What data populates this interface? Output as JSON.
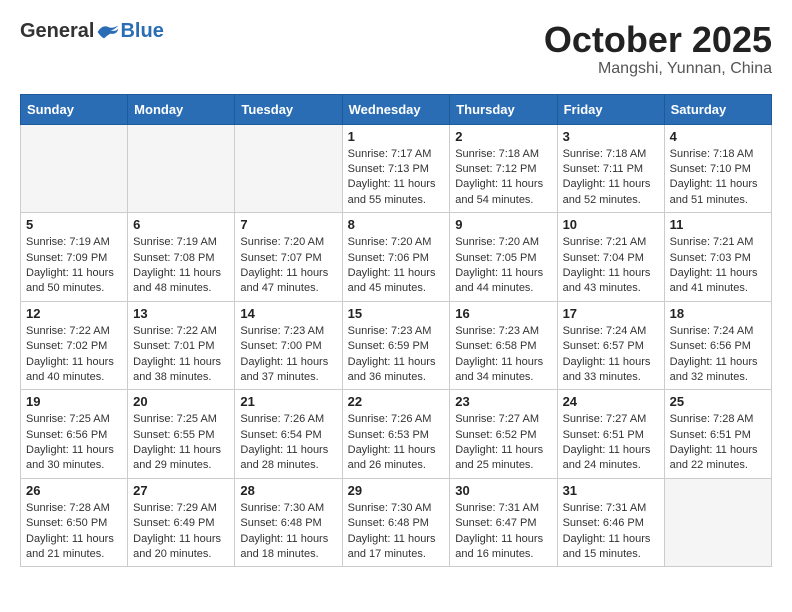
{
  "logo": {
    "general": "General",
    "blue": "Blue"
  },
  "title": "October 2025",
  "location": "Mangshi, Yunnan, China",
  "days_of_week": [
    "Sunday",
    "Monday",
    "Tuesday",
    "Wednesday",
    "Thursday",
    "Friday",
    "Saturday"
  ],
  "weeks": [
    [
      {
        "day": "",
        "info": ""
      },
      {
        "day": "",
        "info": ""
      },
      {
        "day": "",
        "info": ""
      },
      {
        "day": "1",
        "info": "Sunrise: 7:17 AM\nSunset: 7:13 PM\nDaylight: 11 hours and 55 minutes."
      },
      {
        "day": "2",
        "info": "Sunrise: 7:18 AM\nSunset: 7:12 PM\nDaylight: 11 hours and 54 minutes."
      },
      {
        "day": "3",
        "info": "Sunrise: 7:18 AM\nSunset: 7:11 PM\nDaylight: 11 hours and 52 minutes."
      },
      {
        "day": "4",
        "info": "Sunrise: 7:18 AM\nSunset: 7:10 PM\nDaylight: 11 hours and 51 minutes."
      }
    ],
    [
      {
        "day": "5",
        "info": "Sunrise: 7:19 AM\nSunset: 7:09 PM\nDaylight: 11 hours and 50 minutes."
      },
      {
        "day": "6",
        "info": "Sunrise: 7:19 AM\nSunset: 7:08 PM\nDaylight: 11 hours and 48 minutes."
      },
      {
        "day": "7",
        "info": "Sunrise: 7:20 AM\nSunset: 7:07 PM\nDaylight: 11 hours and 47 minutes."
      },
      {
        "day": "8",
        "info": "Sunrise: 7:20 AM\nSunset: 7:06 PM\nDaylight: 11 hours and 45 minutes."
      },
      {
        "day": "9",
        "info": "Sunrise: 7:20 AM\nSunset: 7:05 PM\nDaylight: 11 hours and 44 minutes."
      },
      {
        "day": "10",
        "info": "Sunrise: 7:21 AM\nSunset: 7:04 PM\nDaylight: 11 hours and 43 minutes."
      },
      {
        "day": "11",
        "info": "Sunrise: 7:21 AM\nSunset: 7:03 PM\nDaylight: 11 hours and 41 minutes."
      }
    ],
    [
      {
        "day": "12",
        "info": "Sunrise: 7:22 AM\nSunset: 7:02 PM\nDaylight: 11 hours and 40 minutes."
      },
      {
        "day": "13",
        "info": "Sunrise: 7:22 AM\nSunset: 7:01 PM\nDaylight: 11 hours and 38 minutes."
      },
      {
        "day": "14",
        "info": "Sunrise: 7:23 AM\nSunset: 7:00 PM\nDaylight: 11 hours and 37 minutes."
      },
      {
        "day": "15",
        "info": "Sunrise: 7:23 AM\nSunset: 6:59 PM\nDaylight: 11 hours and 36 minutes."
      },
      {
        "day": "16",
        "info": "Sunrise: 7:23 AM\nSunset: 6:58 PM\nDaylight: 11 hours and 34 minutes."
      },
      {
        "day": "17",
        "info": "Sunrise: 7:24 AM\nSunset: 6:57 PM\nDaylight: 11 hours and 33 minutes."
      },
      {
        "day": "18",
        "info": "Sunrise: 7:24 AM\nSunset: 6:56 PM\nDaylight: 11 hours and 32 minutes."
      }
    ],
    [
      {
        "day": "19",
        "info": "Sunrise: 7:25 AM\nSunset: 6:56 PM\nDaylight: 11 hours and 30 minutes."
      },
      {
        "day": "20",
        "info": "Sunrise: 7:25 AM\nSunset: 6:55 PM\nDaylight: 11 hours and 29 minutes."
      },
      {
        "day": "21",
        "info": "Sunrise: 7:26 AM\nSunset: 6:54 PM\nDaylight: 11 hours and 28 minutes."
      },
      {
        "day": "22",
        "info": "Sunrise: 7:26 AM\nSunset: 6:53 PM\nDaylight: 11 hours and 26 minutes."
      },
      {
        "day": "23",
        "info": "Sunrise: 7:27 AM\nSunset: 6:52 PM\nDaylight: 11 hours and 25 minutes."
      },
      {
        "day": "24",
        "info": "Sunrise: 7:27 AM\nSunset: 6:51 PM\nDaylight: 11 hours and 24 minutes."
      },
      {
        "day": "25",
        "info": "Sunrise: 7:28 AM\nSunset: 6:51 PM\nDaylight: 11 hours and 22 minutes."
      }
    ],
    [
      {
        "day": "26",
        "info": "Sunrise: 7:28 AM\nSunset: 6:50 PM\nDaylight: 11 hours and 21 minutes."
      },
      {
        "day": "27",
        "info": "Sunrise: 7:29 AM\nSunset: 6:49 PM\nDaylight: 11 hours and 20 minutes."
      },
      {
        "day": "28",
        "info": "Sunrise: 7:30 AM\nSunset: 6:48 PM\nDaylight: 11 hours and 18 minutes."
      },
      {
        "day": "29",
        "info": "Sunrise: 7:30 AM\nSunset: 6:48 PM\nDaylight: 11 hours and 17 minutes."
      },
      {
        "day": "30",
        "info": "Sunrise: 7:31 AM\nSunset: 6:47 PM\nDaylight: 11 hours and 16 minutes."
      },
      {
        "day": "31",
        "info": "Sunrise: 7:31 AM\nSunset: 6:46 PM\nDaylight: 11 hours and 15 minutes."
      },
      {
        "day": "",
        "info": ""
      }
    ]
  ]
}
